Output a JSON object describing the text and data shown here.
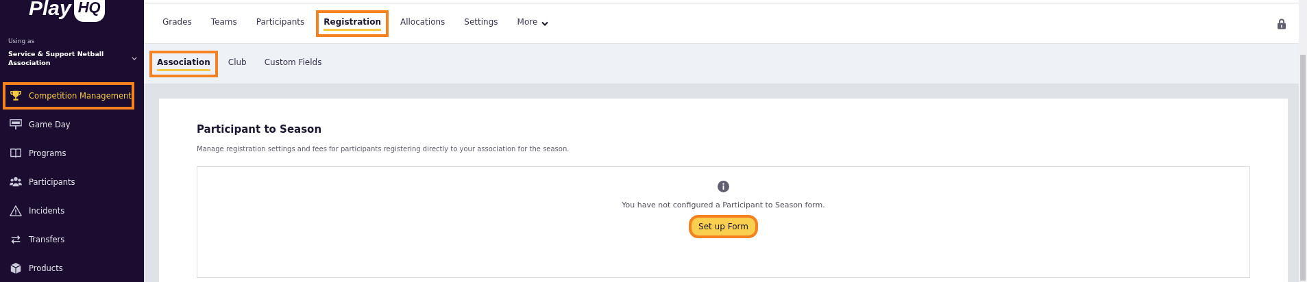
{
  "sidebar": {
    "logo": {
      "word": "Play",
      "badge": "HQ"
    },
    "using_as_label": "Using as",
    "organisation": "Service & Support Netball Association",
    "items": [
      {
        "label": "Competition Management",
        "selected": true,
        "highlighted": true
      },
      {
        "label": "Game Day",
        "selected": false,
        "highlighted": false
      },
      {
        "label": "Programs",
        "selected": false,
        "highlighted": false
      },
      {
        "label": "Participants",
        "selected": false,
        "highlighted": false
      },
      {
        "label": "Incidents",
        "selected": false,
        "highlighted": false
      },
      {
        "label": "Transfers",
        "selected": false,
        "highlighted": false
      },
      {
        "label": "Products",
        "selected": false,
        "highlighted": false
      }
    ]
  },
  "top_tabs": [
    {
      "label": "Grades",
      "selected": false,
      "highlighted": false
    },
    {
      "label": "Teams",
      "selected": false,
      "highlighted": false
    },
    {
      "label": "Participants",
      "selected": false,
      "highlighted": false
    },
    {
      "label": "Registration",
      "selected": true,
      "highlighted": true
    },
    {
      "label": "Allocations",
      "selected": false,
      "highlighted": false
    },
    {
      "label": "Settings",
      "selected": false,
      "highlighted": false
    },
    {
      "label": "More",
      "selected": false,
      "highlighted": false,
      "dropdown": true
    }
  ],
  "sub_tabs": [
    {
      "label": "Association",
      "selected": true,
      "highlighted": true
    },
    {
      "label": "Club",
      "selected": false,
      "highlighted": false
    },
    {
      "label": "Custom Fields",
      "selected": false,
      "highlighted": false
    }
  ],
  "section": {
    "title": "Participant to Season",
    "description": "Manage registration settings and fees for participants registering directly to your association for the season.",
    "empty_state": {
      "message": "You have not configured a Participant to Season form.",
      "button": {
        "label": "Set up Form",
        "highlighted": true
      }
    }
  }
}
